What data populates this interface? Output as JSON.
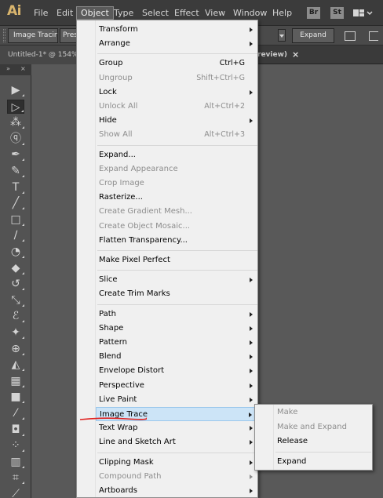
{
  "app": {
    "logo": "Ai"
  },
  "menubar": {
    "items": [
      "File",
      "Edit",
      "Object",
      "Type",
      "Select",
      "Effect",
      "View",
      "Window",
      "Help"
    ],
    "active": "Object",
    "bridge_label": "Br",
    "stock_label": "St",
    "workspace_icon": "workspace-switcher-icon"
  },
  "controlbar": {
    "image_tracing_label": "Image Tracing",
    "preset_label": "Pres",
    "expand_label": "Expand"
  },
  "tabs": {
    "doc1": "Untitled-1* @ 154%",
    "doc2": "review)",
    "close": "×"
  },
  "toolbox": {
    "head_left": "»",
    "head_right": "×",
    "tools": [
      {
        "icon": "selection-tool-icon",
        "glyph": "▶"
      },
      {
        "icon": "direct-selection-tool-icon",
        "glyph": "▷"
      },
      {
        "icon": "magic-wand-tool-icon",
        "glyph": "⁂"
      },
      {
        "icon": "lasso-tool-icon",
        "glyph": "ⓠ"
      },
      {
        "icon": "pen-tool-icon",
        "glyph": "✒"
      },
      {
        "icon": "curvature-tool-icon",
        "glyph": "✎"
      },
      {
        "icon": "type-tool-icon",
        "glyph": "T"
      },
      {
        "icon": "line-segment-tool-icon",
        "glyph": "╱"
      },
      {
        "icon": "rectangle-tool-icon",
        "glyph": "□"
      },
      {
        "icon": "paintbrush-tool-icon",
        "glyph": "∕"
      },
      {
        "icon": "blob-brush-tool-icon",
        "glyph": "◔"
      },
      {
        "icon": "eraser-tool-icon",
        "glyph": "◆"
      },
      {
        "icon": "rotate-tool-icon",
        "glyph": "↺"
      },
      {
        "icon": "scale-tool-icon",
        "glyph": "⤡"
      },
      {
        "icon": "warp-tool-icon",
        "glyph": "ℰ"
      },
      {
        "icon": "puppet-warp-tool-icon",
        "glyph": "✦"
      },
      {
        "icon": "shape-builder-tool-icon",
        "glyph": "⊕"
      },
      {
        "icon": "perspective-grid-tool-icon",
        "glyph": "◭"
      },
      {
        "icon": "mesh-tool-icon",
        "glyph": "▦"
      },
      {
        "icon": "gradient-tool-icon",
        "glyph": "■"
      },
      {
        "icon": "eyedropper-tool-icon",
        "glyph": "⁄"
      },
      {
        "icon": "blend-tool-icon",
        "glyph": "◘"
      },
      {
        "icon": "symbol-sprayer-tool-icon",
        "glyph": "⁘"
      },
      {
        "icon": "column-graph-tool-icon",
        "glyph": "▥"
      },
      {
        "icon": "artboard-tool-icon",
        "glyph": "⌗"
      },
      {
        "icon": "slice-tool-icon",
        "glyph": "⟋"
      }
    ]
  },
  "object_menu": {
    "items": [
      {
        "label": "Transform",
        "sub": true
      },
      {
        "label": "Arrange",
        "sub": true
      },
      {
        "sep": true
      },
      {
        "label": "Group",
        "shortcut": "Ctrl+G"
      },
      {
        "label": "Ungroup",
        "shortcut": "Shift+Ctrl+G",
        "disabled": true
      },
      {
        "label": "Lock",
        "sub": true
      },
      {
        "label": "Unlock All",
        "shortcut": "Alt+Ctrl+2",
        "disabled": true
      },
      {
        "label": "Hide",
        "sub": true
      },
      {
        "label": "Show All",
        "shortcut": "Alt+Ctrl+3",
        "disabled": true
      },
      {
        "sep": true
      },
      {
        "label": "Expand..."
      },
      {
        "label": "Expand Appearance",
        "disabled": true
      },
      {
        "label": "Crop Image",
        "disabled": true
      },
      {
        "label": "Rasterize..."
      },
      {
        "label": "Create Gradient Mesh...",
        "disabled": true
      },
      {
        "label": "Create Object Mosaic...",
        "disabled": true
      },
      {
        "label": "Flatten Transparency..."
      },
      {
        "sep": true
      },
      {
        "label": "Make Pixel Perfect"
      },
      {
        "sep": true
      },
      {
        "label": "Slice",
        "sub": true
      },
      {
        "label": "Create Trim Marks"
      },
      {
        "sep": true
      },
      {
        "label": "Path",
        "sub": true
      },
      {
        "label": "Shape",
        "sub": true
      },
      {
        "label": "Pattern",
        "sub": true
      },
      {
        "label": "Blend",
        "sub": true
      },
      {
        "label": "Envelope Distort",
        "sub": true
      },
      {
        "label": "Perspective",
        "sub": true
      },
      {
        "label": "Live Paint",
        "sub": true
      },
      {
        "label": "Image Trace",
        "sub": true,
        "highlighted": true
      },
      {
        "label": "Text Wrap",
        "sub": true
      },
      {
        "label": "Line and Sketch Art",
        "sub": true
      },
      {
        "sep": true
      },
      {
        "label": "Clipping Mask",
        "sub": true
      },
      {
        "label": "Compound Path",
        "sub": true,
        "disabled": true
      },
      {
        "label": "Artboards",
        "sub": true
      }
    ]
  },
  "image_trace_submenu": {
    "items": [
      {
        "label": "Make",
        "disabled": true
      },
      {
        "label": "Make and Expand",
        "disabled": true
      },
      {
        "label": "Release"
      },
      {
        "sep": true
      },
      {
        "label": "Expand"
      }
    ]
  },
  "colors": {
    "highlight": "#cce4f7",
    "annotation_underline": "#e0201e",
    "logo": "#d9b56d"
  }
}
